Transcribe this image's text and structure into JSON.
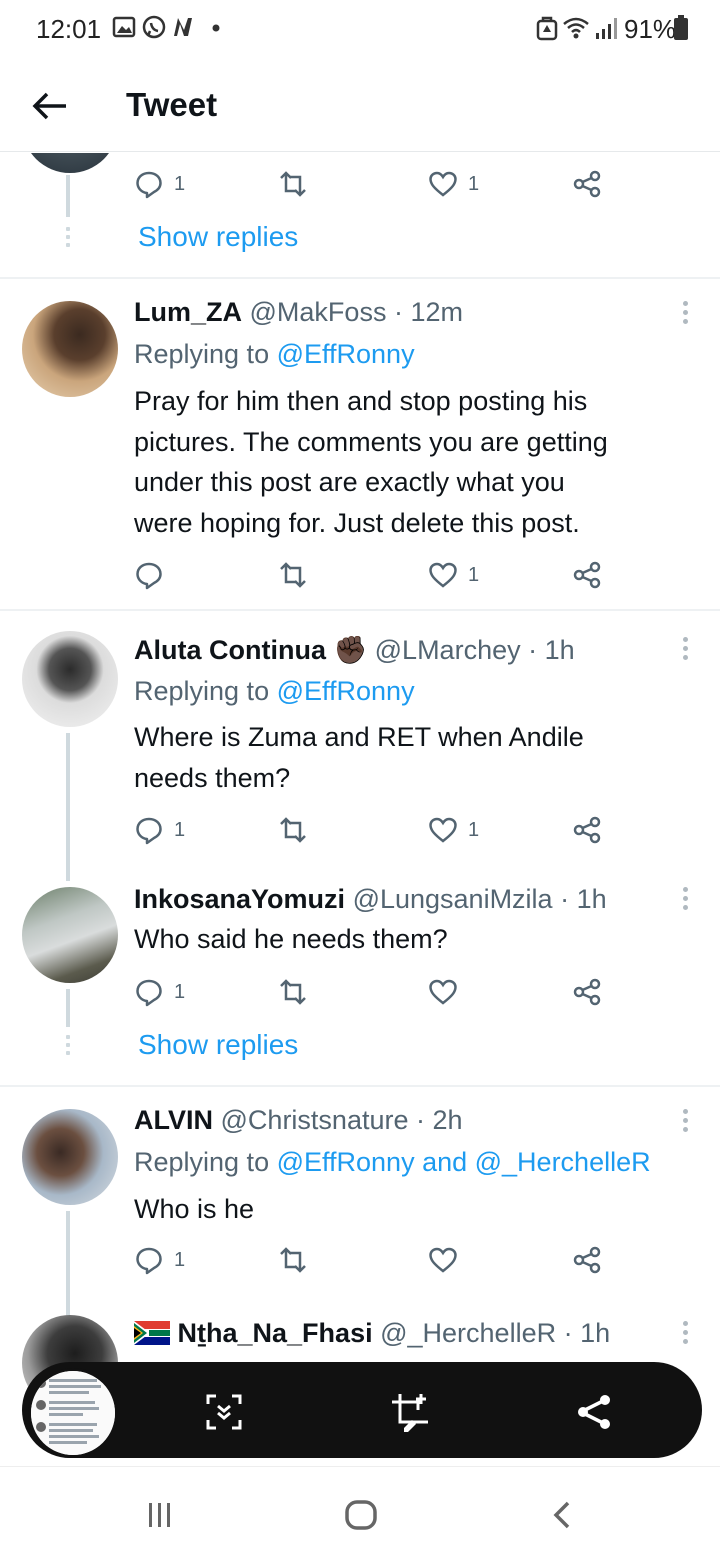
{
  "status": {
    "time": "12:01",
    "battery": "91%"
  },
  "appbar": {
    "title": "Tweet"
  },
  "top_fragment": {
    "reply_count": "1",
    "like_count": "1",
    "show_replies": "Show replies"
  },
  "tweets": [
    {
      "name": "Lum_ZA",
      "handle": "@MakFoss",
      "time": "· 12m",
      "replying_prefix": "Replying to ",
      "replying_to": "@EffRonny",
      "lines": [
        "Pray for him then and stop posting his",
        "pictures. The comments you are getting",
        "under this post are exactly what you",
        "were hoping for. Just delete this post."
      ],
      "reply_count": "",
      "like_count": "1"
    },
    {
      "name": "Aluta Continua",
      "emoji": "✊🏿",
      "handle": "@LMarchey",
      "time": "· 1h",
      "replying_prefix": "Replying to ",
      "replying_to": "@EffRonny",
      "lines": [
        "Where is Zuma and RET when Andile",
        "needs them?"
      ],
      "reply_count": "1",
      "like_count": "1"
    },
    {
      "name": "InkosanaYomuzi",
      "handle": "@LungsaniMzila",
      "time": "· 1h",
      "lines": [
        "Who said he needs them?"
      ],
      "reply_count": "1",
      "like_count": "",
      "show_replies": "Show replies"
    },
    {
      "name": "ALVIN",
      "handle": "@Christsnature",
      "time": "· 2h",
      "replying_prefix": "Replying to ",
      "replying_to": "@EffRonny and @_HerchelleR",
      "lines": [
        "Who is he"
      ],
      "reply_count": "1",
      "like_count": ""
    },
    {
      "name": "Nṯha_Na_Fhasi",
      "handle": "@_HerchelleR",
      "time": "· 1h"
    }
  ],
  "colors": {
    "link": "#1d9bf0",
    "muted": "#536471",
    "text": "#0f1419",
    "thread": "#cfd9de"
  }
}
